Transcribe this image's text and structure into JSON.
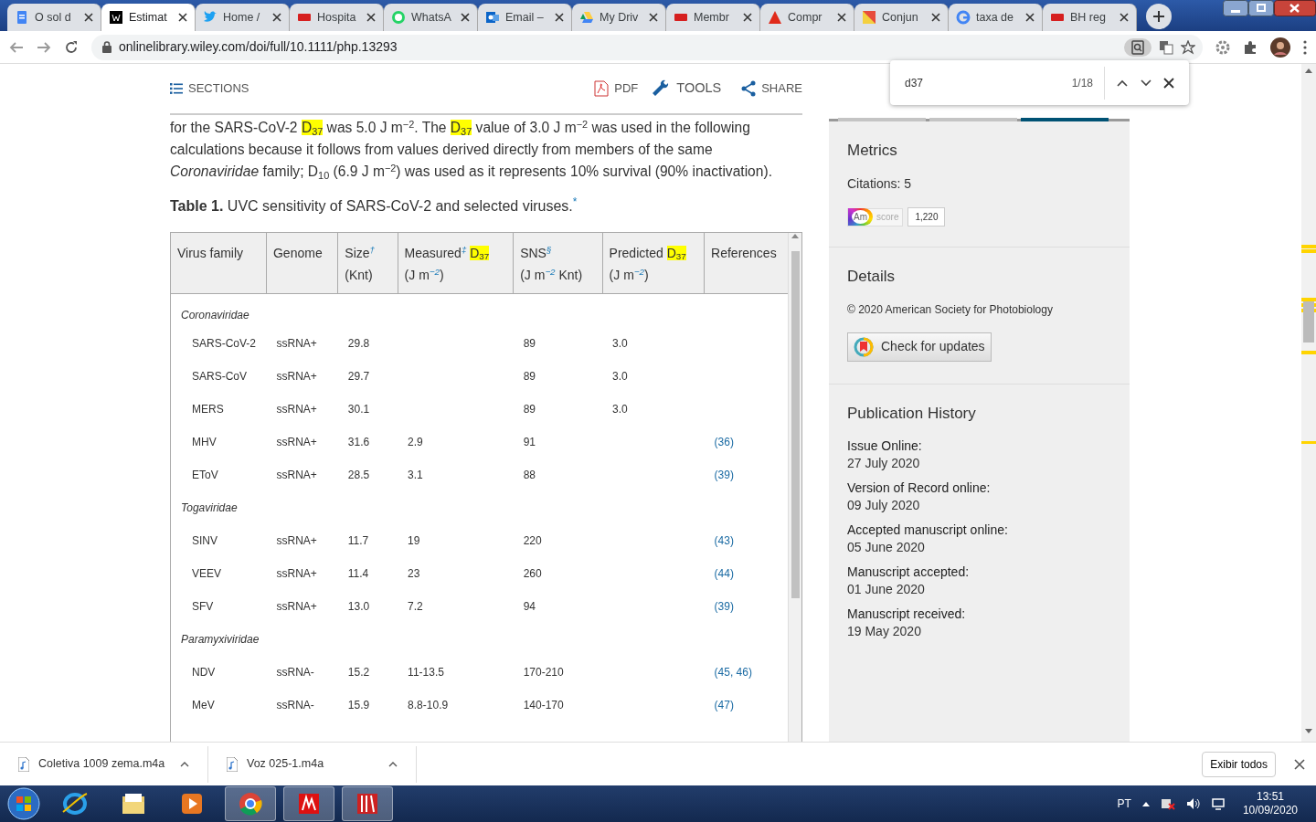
{
  "browser_tabs": [
    {
      "title": "O sol d",
      "selected": false
    },
    {
      "title": "Estimat",
      "selected": true
    },
    {
      "title": "Home /",
      "selected": false
    },
    {
      "title": "Hospita",
      "selected": false
    },
    {
      "title": "WhatsA",
      "selected": false
    },
    {
      "title": "Email –",
      "selected": false
    },
    {
      "title": "My Driv",
      "selected": false
    },
    {
      "title": "Membr",
      "selected": false
    },
    {
      "title": "Compr",
      "selected": false
    },
    {
      "title": "Conjun",
      "selected": false
    },
    {
      "title": "taxa de",
      "selected": false
    },
    {
      "title": "BH reg",
      "selected": false
    }
  ],
  "address_bar": {
    "url": "onlinelibrary.wiley.com/doi/full/10.1111/php.13293"
  },
  "find_bar": {
    "query": "d37",
    "count": "1/18"
  },
  "article_toolbar": {
    "sections": "SECTIONS",
    "pdf": "PDF",
    "tools": "TOOLS",
    "share": "SHARE"
  },
  "paragraph": [
    {
      "text": "for the SARS-CoV-2 ",
      "highlight": false
    },
    {
      "text": "D$_{37}$",
      "highlight": true
    },
    {
      "text": " was 5.0 J m$^{−2}$. The ",
      "highlight": false
    },
    {
      "text": "D$_{37}$",
      "highlight": true
    },
    {
      "text": " value of 3.0 J m$^{−2}$ was used in the following calculations because it follows from values derived directly from members of the same *Coronaviridae* family; D$_{10}$ (6.9 J m$^{−2}$) was used as it represents 10% survival (90% inactivation).",
      "highlight": false
    }
  ],
  "table_caption": {
    "label": "Table 1.",
    "text": "UVC sensitivity of SARS-CoV-2 and selected viruses.$^{*}$"
  },
  "table": {
    "columns": [
      {
        "label": "Virus family"
      },
      {
        "label": "Genome"
      },
      {
        "label": "Size$^{†}$",
        "unit": "(Knt)"
      },
      {
        "label": "Measured$^{‡}$",
        "term": "D$_{37}$",
        "unit": "(J m$^{−2}$)"
      },
      {
        "label": "SNS$^{§}$",
        "unit": "(J m$^{−2}$ Knt)"
      },
      {
        "label": "Predicted",
        "term": "D$_{37}$",
        "unit": "(J m$^{−2}$)"
      },
      {
        "label": "References"
      }
    ],
    "groups": [
      {
        "family": "Coronaviridae",
        "rows": [
          {
            "virus": "SARS-CoV-2",
            "genome": "ssRNA+",
            "size": "29.8",
            "sns": "89",
            "predicted": "3.0"
          },
          {
            "virus": "SARS-CoV",
            "genome": "ssRNA+",
            "size": "29.7",
            "sns": "89",
            "predicted": "3.0"
          },
          {
            "virus": "MERS",
            "genome": "ssRNA+",
            "size": "30.1",
            "sns": "89",
            "predicted": "3.0"
          },
          {
            "virus": "MHV",
            "genome": "ssRNA+",
            "size": "31.6",
            "measured": "2.9",
            "sns": "91",
            "references": "(36)"
          },
          {
            "virus": "EToV",
            "genome": "ssRNA+",
            "size": "28.5",
            "measured": "3.1",
            "sns": "88",
            "references": "(39)"
          }
        ]
      },
      {
        "family": "Togaviridae",
        "rows": [
          {
            "virus": "SINV",
            "genome": "ssRNA+",
            "size": "11.7",
            "measured": "19",
            "sns": "220",
            "references": "(43)"
          },
          {
            "virus": "VEEV",
            "genome": "ssRNA+",
            "size": "11.4",
            "measured": "23",
            "sns": "260",
            "references": "(44)"
          },
          {
            "virus": "SFV",
            "genome": "ssRNA+",
            "size": "13.0",
            "measured": "7.2",
            "sns": "94",
            "references": "(39)"
          }
        ]
      },
      {
        "family": "Paramyxiviridae",
        "rows": [
          {
            "virus": "NDV",
            "genome": "ssRNA-",
            "size": "15.2",
            "measured": "11-13.5",
            "sns": "170-210",
            "references": "(45, 46)"
          },
          {
            "virus": "MeV",
            "genome": "ssRNA-",
            "size": "15.9",
            "measured": "8.8-10.9",
            "sns": "140-170",
            "references": "(47)"
          }
        ]
      }
    ]
  },
  "sidebar": {
    "tabs": [
      {
        "selected": false
      },
      {
        "selected": false
      },
      {
        "selected": true
      }
    ],
    "metrics": {
      "title": "Metrics",
      "citations": "Citations: 5",
      "badge_label": "Am",
      "badge_score": "score",
      "badge_value": "1,220"
    },
    "details": {
      "title": "Details",
      "copyright": "© 2020 American Society for Photobiology",
      "button": "Check for updates"
    },
    "history": {
      "title": "Publication History",
      "items": [
        {
          "label": "Issue Online:",
          "value": "27 July 2020"
        },
        {
          "label": "Version of Record online:",
          "value": "09 July 2020"
        },
        {
          "label": "Accepted manuscript online:",
          "value": "05 June 2020"
        },
        {
          "label": "Manuscript accepted:",
          "value": "01 June 2020"
        },
        {
          "label": "Manuscript received:",
          "value": "19 May 2020"
        }
      ]
    }
  },
  "downloads": {
    "items": [
      {
        "name": "Coletiva 1009 zema.m4a"
      },
      {
        "name": "Voz 025-1.m4a"
      }
    ],
    "show_all": "Exibir todos"
  },
  "taskbar": {
    "language": "PT",
    "time": "13:51",
    "date": "10/09/2020"
  }
}
